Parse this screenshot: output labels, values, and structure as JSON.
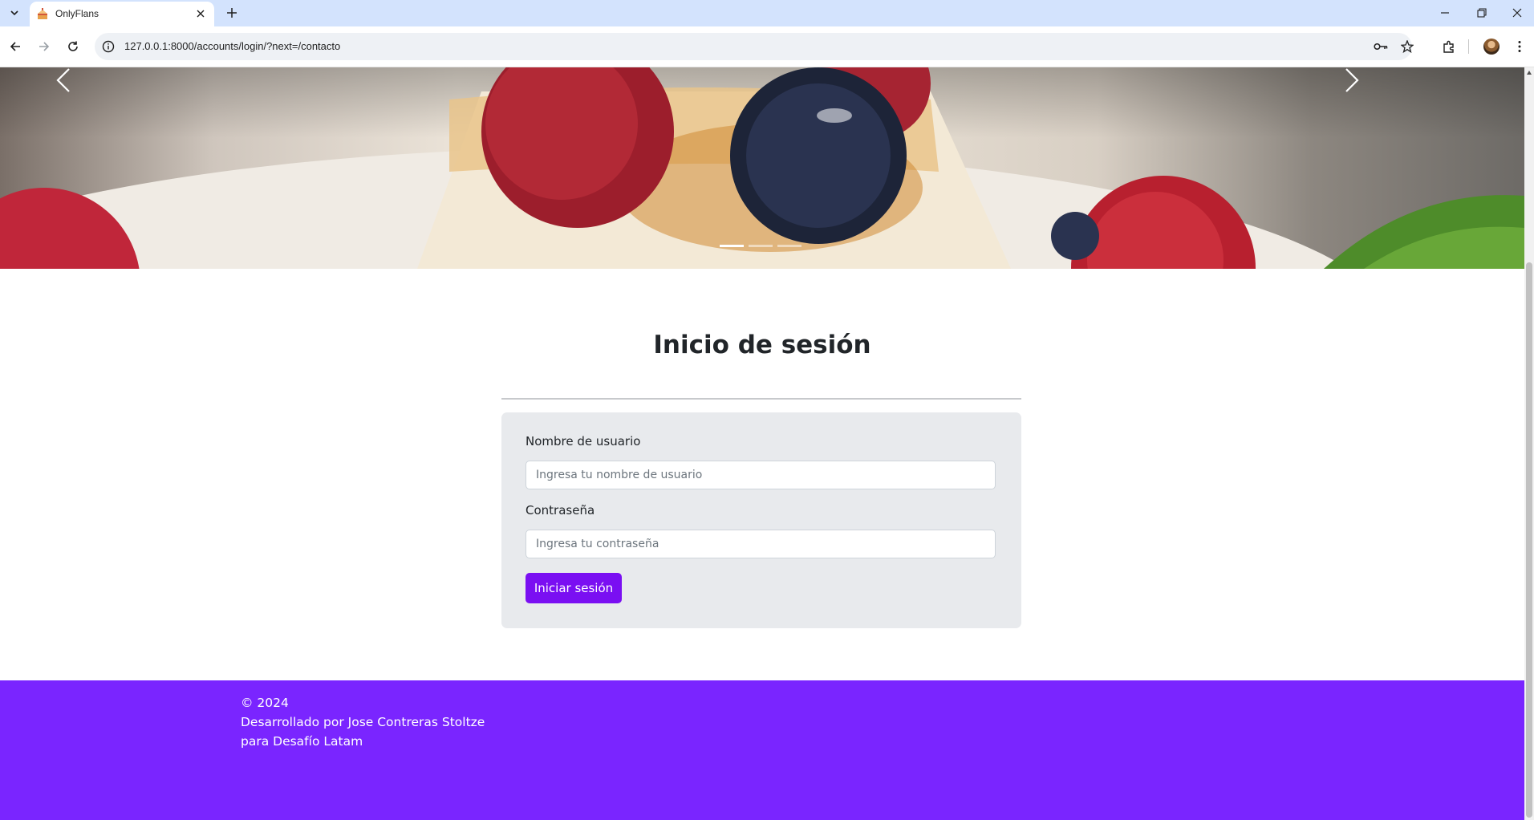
{
  "browser": {
    "tab_title": "OnlyFlans",
    "url": "127.0.0.1:8000/accounts/login/?next=/contacto"
  },
  "carousel": {
    "slide_count": 3,
    "active_index": 0
  },
  "login": {
    "title": "Inicio de sesión",
    "username_label": "Nombre de usuario",
    "username_placeholder": "Ingresa tu nombre de usuario",
    "password_label": "Contraseña",
    "password_placeholder": "Ingresa tu contraseña",
    "submit_label": "Iniciar sesión"
  },
  "footer": {
    "copyright": "© 2024",
    "credit": "Desarrollado por Jose Contreras Stoltze",
    "org": "para Desafío Latam"
  },
  "colors": {
    "accent": "#7a0ff2",
    "footer_bg": "#7a25ff",
    "card_bg": "#e8eaed",
    "tabstrip_bg": "#d3e3fd"
  }
}
